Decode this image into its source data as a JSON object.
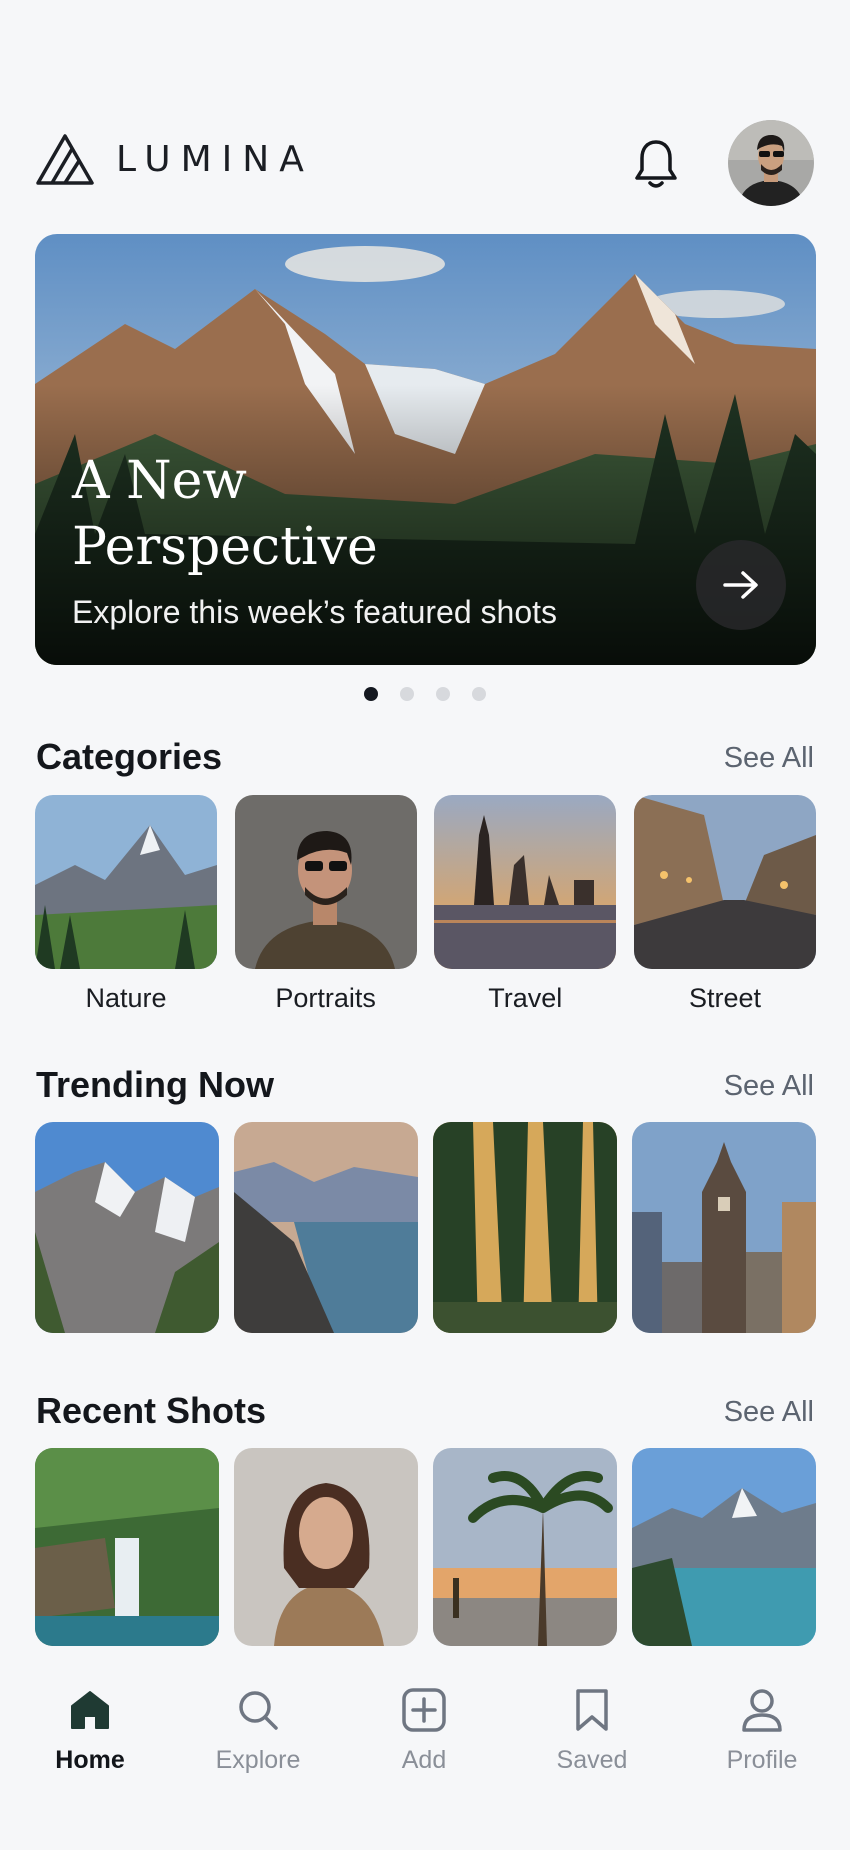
{
  "header": {
    "brand": "LUMINA"
  },
  "hero": {
    "title": "A New Perspective",
    "subtitle": "Explore this week’s featured shots",
    "slide_count": 4,
    "active_slide": 1
  },
  "categories": {
    "title": "Categories",
    "see_all": "See All",
    "items": [
      {
        "label": "Nature"
      },
      {
        "label": "Portraits"
      },
      {
        "label": "Travel"
      },
      {
        "label": "Street"
      }
    ]
  },
  "trending": {
    "title": "Trending Now",
    "see_all": "See All"
  },
  "recent": {
    "title": "Recent Shots",
    "see_all": "See All"
  },
  "tabbar": {
    "items": [
      {
        "label": "Home",
        "icon": "home-icon",
        "active": true
      },
      {
        "label": "Explore",
        "icon": "search-icon",
        "active": false
      },
      {
        "label": "Add",
        "icon": "plus-square-icon",
        "active": false
      },
      {
        "label": "Saved",
        "icon": "bookmark-icon",
        "active": false
      },
      {
        "label": "Profile",
        "icon": "user-icon",
        "active": false
      }
    ]
  },
  "colors": {
    "accent": "#1f3a33",
    "text": "#14171c",
    "muted": "#8a8f98",
    "background": "#f6f7f9"
  }
}
